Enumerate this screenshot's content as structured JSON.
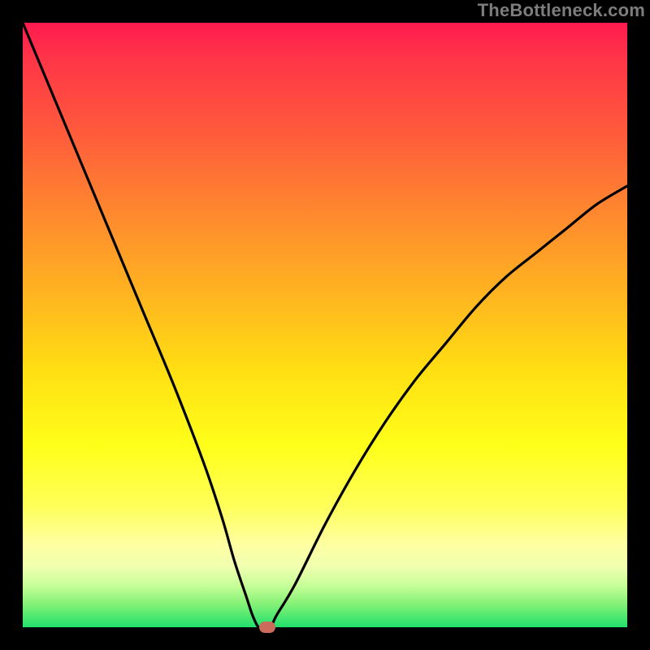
{
  "watermark": "TheBottleneck.com",
  "colors": {
    "frame": "#000000",
    "curve": "#000000",
    "marker": "#cc6a5c",
    "gradient_top": "#ff1a4f",
    "gradient_bottom": "#20e06c"
  },
  "chart_data": {
    "type": "line",
    "title": "",
    "xlabel": "",
    "ylabel": "",
    "xlim": [
      0,
      100
    ],
    "ylim": [
      0,
      100
    ],
    "x": [
      0,
      5,
      10,
      15,
      20,
      25,
      30,
      33,
      35,
      37,
      38,
      39,
      40,
      41,
      42,
      45,
      50,
      55,
      60,
      65,
      70,
      75,
      80,
      85,
      90,
      95,
      100
    ],
    "values": [
      100,
      88,
      76,
      64,
      52,
      40,
      27,
      18,
      11,
      5,
      2,
      0,
      0,
      0,
      2,
      7,
      17,
      26,
      34,
      41,
      47,
      53,
      58,
      62,
      66,
      70,
      73
    ],
    "marker": {
      "x": 40.5,
      "y": 0
    }
  }
}
